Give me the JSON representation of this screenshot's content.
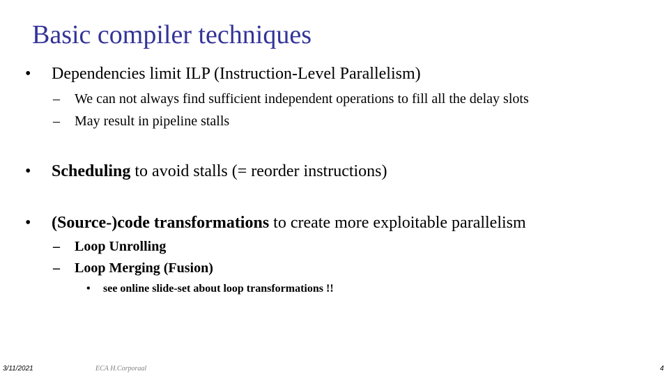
{
  "slide": {
    "title": "Basic compiler techniques",
    "title_color": "#333399",
    "bullets": [
      {
        "bullet": "•",
        "bold": "",
        "text": "Dependencies limit ILP (Instruction-Level Parallelism)",
        "subitems": [
          {
            "dash": "–",
            "text": "We can not always find sufficient independent operations to fill all the delay slots"
          },
          {
            "dash": "–",
            "text": "May result in pipeline stalls"
          }
        ]
      },
      {
        "bullet": "•",
        "bold": "Scheduling",
        "text": " to avoid stalls (= reorder instructions)"
      },
      {
        "bullet": "•",
        "bold": "(Source-)code transformations",
        "text": " to create more exploitable parallelism",
        "subitems": [
          {
            "dash": "–",
            "text": "Loop Unrolling"
          },
          {
            "dash": "–",
            "text": "Loop Merging (Fusion)"
          }
        ],
        "subsubitems": [
          {
            "bullet": "•",
            "text": "see online slide-set about loop transformations !!"
          }
        ]
      }
    ]
  },
  "footer": {
    "date": "3/11/2021",
    "center": "ECA  H.Corporaal",
    "page": "4"
  }
}
